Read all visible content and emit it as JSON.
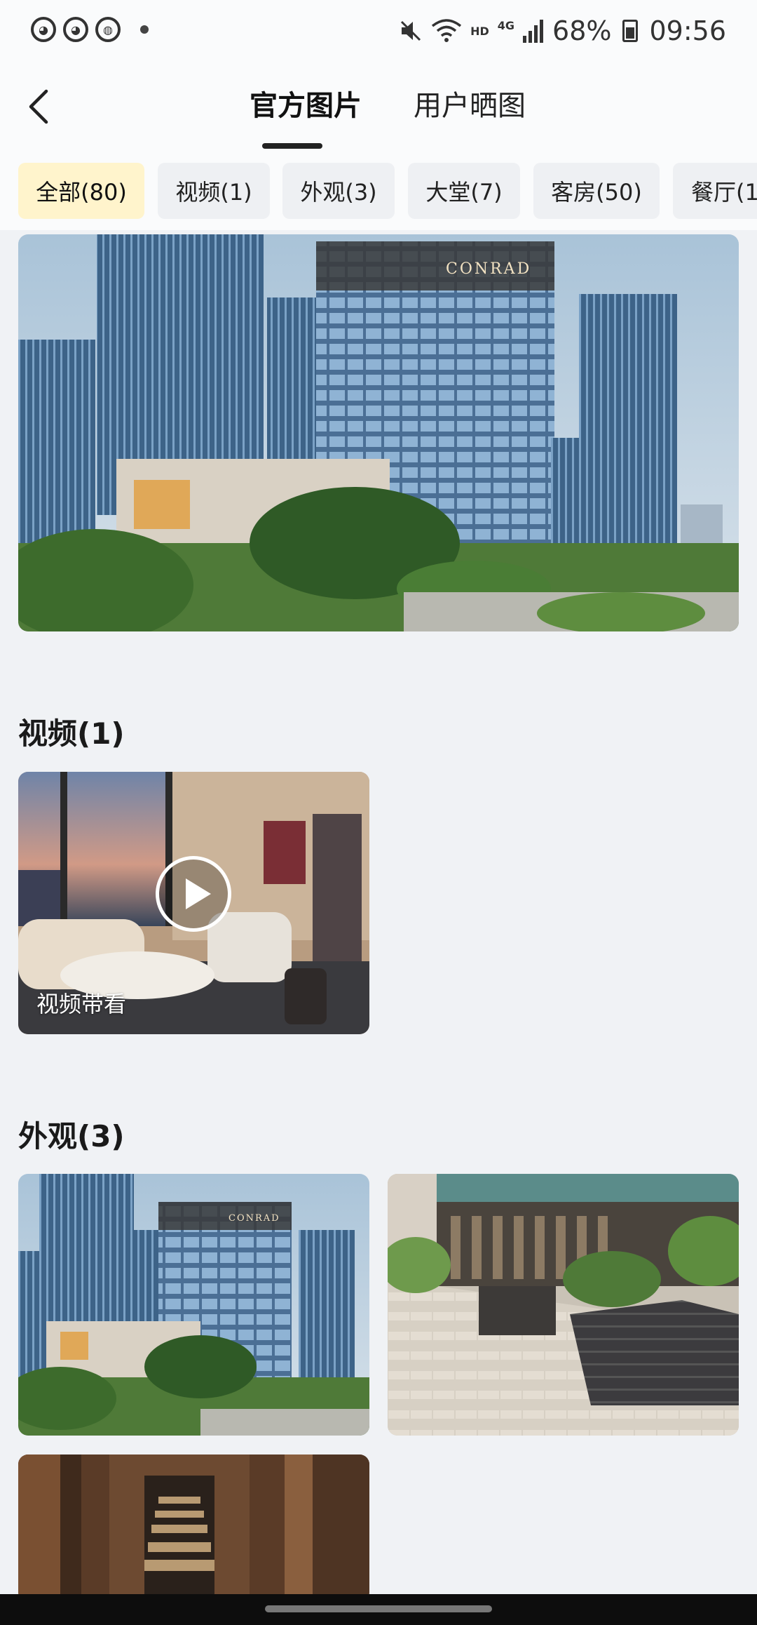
{
  "status_bar": {
    "time": "09:56",
    "battery": "68%",
    "network_label": "4G",
    "hd_label": "HD",
    "icons": [
      "app-pig-icon",
      "app-pig-icon",
      "app-weibo-icon",
      "mute-icon",
      "wifi-icon",
      "signal-icon",
      "battery-icon"
    ]
  },
  "header": {
    "back_icon": "chevron-left-icon",
    "tabs": [
      {
        "label": "官方图片",
        "active": true
      },
      {
        "label": "用户晒图",
        "active": false
      }
    ]
  },
  "categories": [
    {
      "label": "全部(80)",
      "active": true
    },
    {
      "label": "视频(1)",
      "active": false
    },
    {
      "label": "外观(3)",
      "active": false
    },
    {
      "label": "大堂(7)",
      "active": false
    },
    {
      "label": "客房(50)",
      "active": false
    },
    {
      "label": "餐厅(1",
      "active": false
    }
  ],
  "hero": {
    "sign_text": "CONRAD"
  },
  "sections": [
    {
      "title": "视频(1)",
      "items": [
        {
          "caption": "视频带看",
          "type": "video"
        }
      ]
    },
    {
      "title": "外观(3)",
      "items": [
        {
          "caption": "",
          "sign_text": "CONRAD"
        },
        {
          "caption": ""
        },
        {
          "caption": ""
        }
      ]
    }
  ],
  "colors": {
    "accent_chip": "#fff4cc",
    "page_bg": "#f0f2f5",
    "chip_bg": "#eef0f3"
  }
}
